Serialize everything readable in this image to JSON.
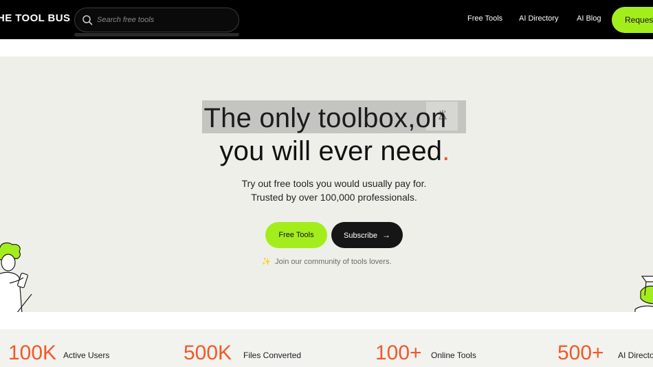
{
  "header": {
    "logo_text": "HE TOOL BUS",
    "search_placeholder": "Search free tools",
    "nav": {
      "free_tools": "Free Tools",
      "ai_directory": "AI Directory",
      "ai_blog": "AI Blog"
    },
    "request_button": "Request"
  },
  "hero": {
    "headline_line1": "The only toolbox,on",
    "headline_line2": "you will ever need",
    "headline_dot": ".",
    "sub_line1": "Try out free tools you would usually pay for.",
    "sub_line2": "Trusted by over 100,000 professionals.",
    "free_tools_button": "Free Tools",
    "subscribe_button": "Subscribe",
    "subscribe_arrow": "→",
    "join_sparkle": "✨",
    "join_text": "Join our community of tools lovers."
  },
  "stats": [
    {
      "value": "100K",
      "label": "Active Users"
    },
    {
      "value": "500K",
      "label": "Files Converted"
    },
    {
      "value": "100+",
      "label": "Online Tools"
    },
    {
      "value": "500+",
      "label": "AI Directo"
    }
  ],
  "colors": {
    "brand_green": "#a4ed1d",
    "accent_orange": "#f0592a",
    "header_bg": "#000000",
    "hero_bg": "#efefea"
  }
}
